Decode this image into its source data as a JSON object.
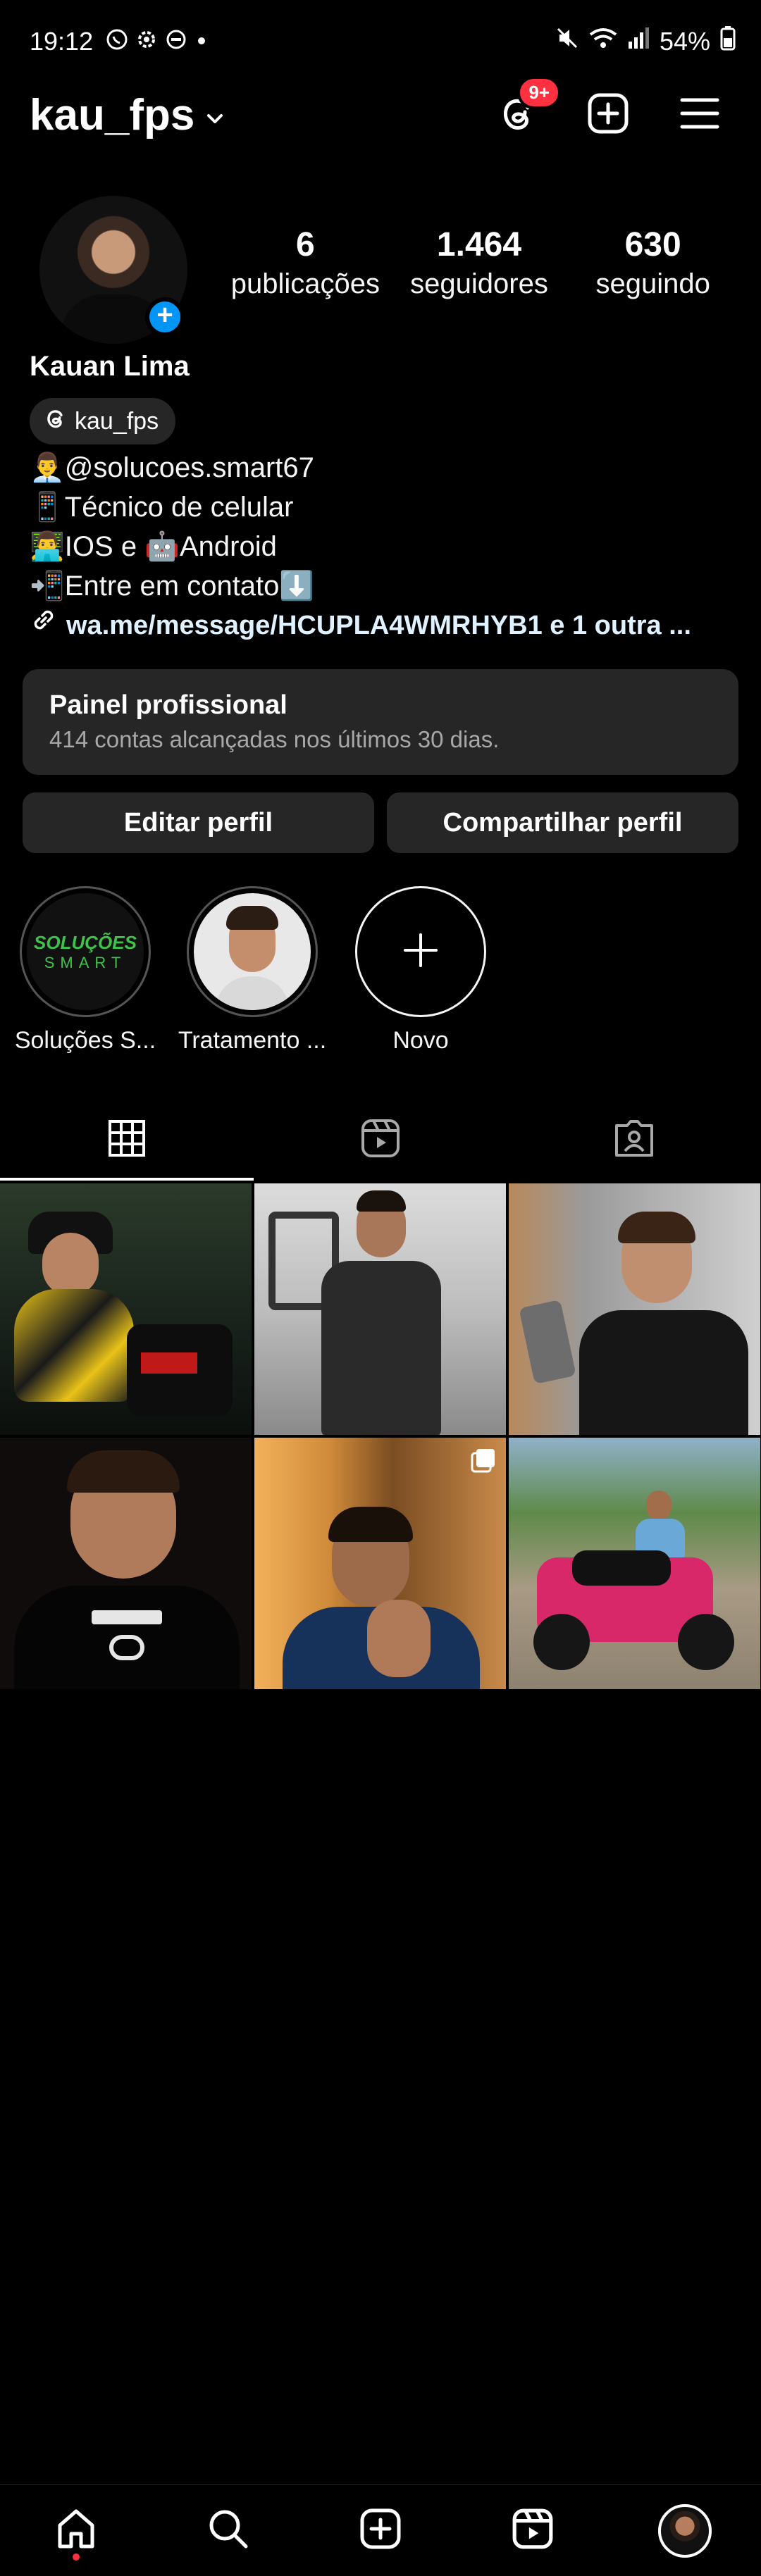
{
  "status_bar": {
    "time": "19:12",
    "battery": "54%"
  },
  "header": {
    "username": "kau_fps",
    "threads_badge": "9+"
  },
  "profile": {
    "stats": [
      {
        "value": "6",
        "label": "publicações"
      },
      {
        "value": "1.464",
        "label": "seguidores"
      },
      {
        "value": "630",
        "label": "seguindo"
      }
    ],
    "full_name": "Kauan Lima",
    "threads_handle": "kau_fps",
    "bio": [
      "👨‍💼@solucoes.smart67",
      "📱Técnico de celular",
      "👨‍💻IOS e 🤖Android",
      "📲Entre em contato⬇️"
    ],
    "link": "wa.me/message/HCUPLA4WMRHYB1 e 1 outra ..."
  },
  "panel": {
    "title": "Painel profissional",
    "subtitle": "414 contas alcançadas nos últimos 30 dias."
  },
  "buttons": {
    "edit": "Editar perfil",
    "share": "Compartilhar perfil"
  },
  "highlights": [
    {
      "label": "Soluções S...",
      "logo_text": "SOLUÇÕES",
      "logo_sub": "SMART"
    },
    {
      "label": "Tratamento ..."
    },
    {
      "label": "Novo"
    }
  ],
  "colors": {
    "background": "#000000",
    "surface": "#262626",
    "accent_blue": "#0095f6",
    "badge_red": "#ff3040",
    "secondary_text": "#a8a8a8"
  },
  "posts": [
    {
      "name": "post-rider-yellow-jacket"
    },
    {
      "name": "post-gym-black-shirt"
    },
    {
      "name": "post-phone-selfie"
    },
    {
      "name": "post-gucci-shirt"
    },
    {
      "name": "post-peace-sign",
      "multi": true
    },
    {
      "name": "post-atv-pink"
    }
  ]
}
